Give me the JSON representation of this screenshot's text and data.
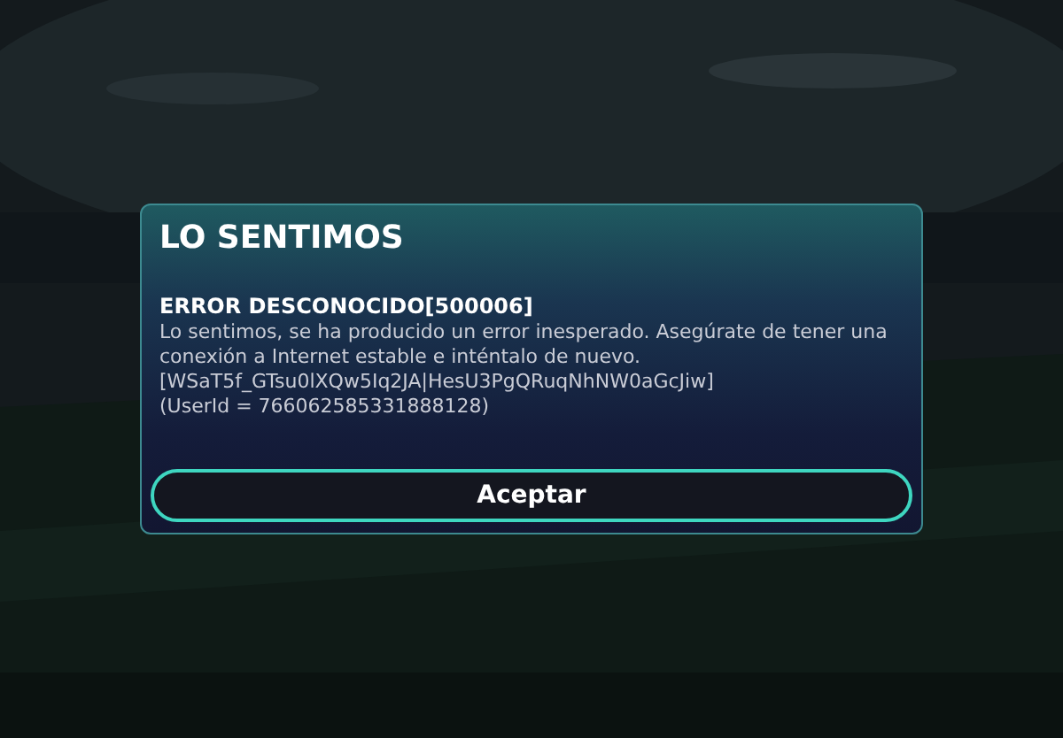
{
  "dialog": {
    "title": "LO SENTIMOS",
    "error_heading": "ERROR DESCONOCIDO[500006]",
    "message": "Lo sentimos, se ha producido un error inesperado. Asegúrate de tener una conexión a Internet estable e inténtalo de nuevo.",
    "code": "[WSaT5f_GTsu0lXQw5Iq2JA|HesU3PgQRuqNhNW0aGcJiw]",
    "user_id": "(UserId = 766062585331888128)",
    "button": "Aceptar"
  }
}
